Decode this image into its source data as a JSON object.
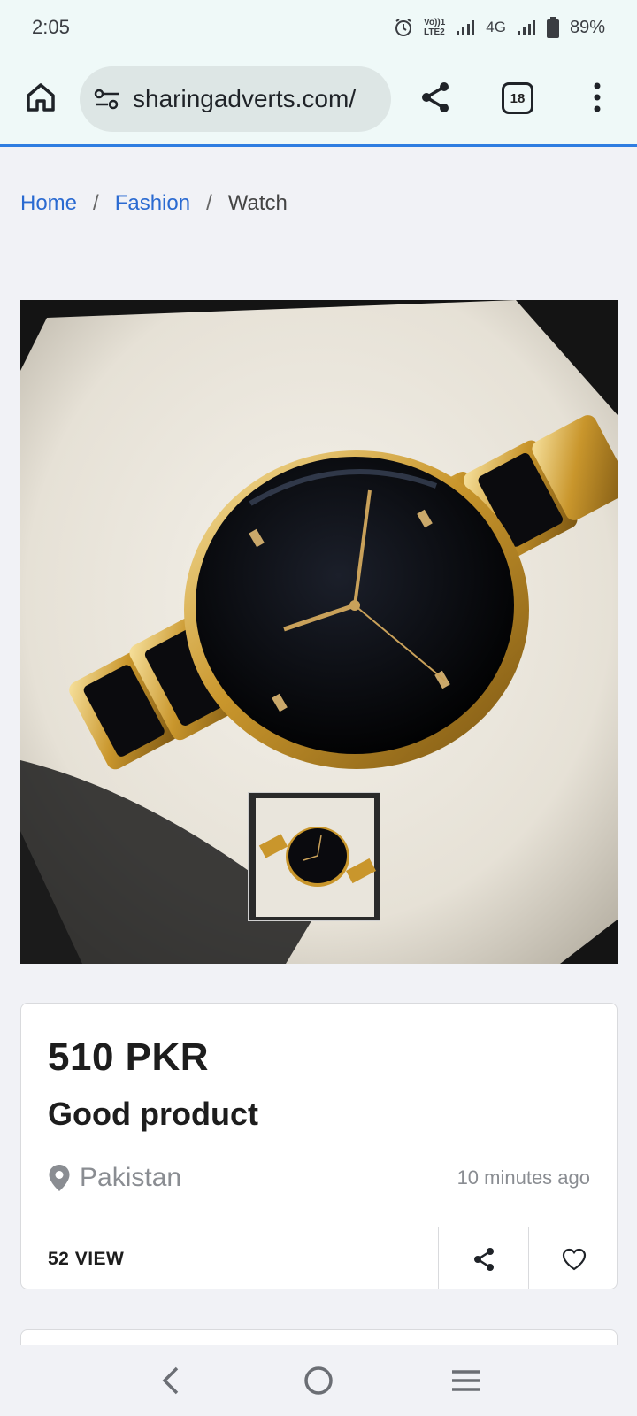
{
  "status_bar": {
    "time": "2:05",
    "volte_line1": "Vo))1",
    "volte_line2": "LTE2",
    "network": "4G",
    "battery": "89%",
    "icons": [
      "alarm-icon",
      "signal-icon",
      "battery-icon"
    ]
  },
  "browser": {
    "url": "sharingadverts.com/",
    "tab_count": "18",
    "accent_color": "#2f7de1"
  },
  "breadcrumb": {
    "items": [
      {
        "label": "Home"
      },
      {
        "label": "Fashion"
      },
      {
        "label": "Watch"
      }
    ],
    "separator": "/"
  },
  "listing": {
    "price": "510 PKR",
    "title": "Good product",
    "location": "Pakistan",
    "posted": "10 minutes ago",
    "views": "52 VIEW"
  },
  "nav": {
    "icons": [
      "back-icon",
      "home-circle-icon",
      "recents-icon"
    ]
  }
}
